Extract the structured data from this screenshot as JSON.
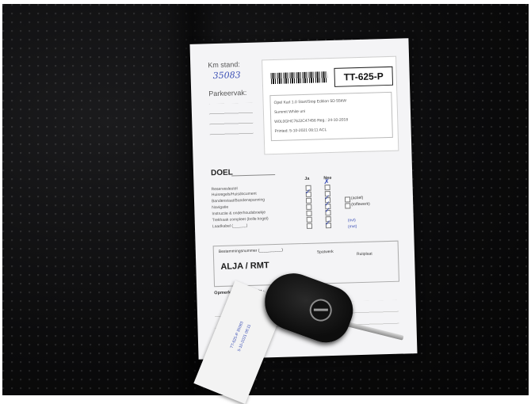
{
  "sheet": {
    "km_label": "Km stand:",
    "km_value": "35083",
    "park_label": "Parkeervak:",
    "plate": "TT-625-P",
    "info": [
      "Opel Karl 1.0 Start/Stop Edition 5D 55kW",
      "Summit White uni",
      "W0L0GHC76J2C47456          Reg.: 24-10-2018",
      "Printed: 5-10-2021 08:11                           ACL"
    ],
    "doel_label": "DOEL",
    "col_ja": "Ja",
    "col_nee": "Nee",
    "rows": [
      "Reservesleutel",
      "Huisregels/Huisdocument",
      "Bandenstaat/Bandenspanning",
      "Navigatie",
      "Instructie & onderhoudsboekje",
      "Trekhaak compleet (bolle kogel)",
      "Laadkabel (______)"
    ],
    "side_labels": [
      "(actief)",
      "(toffewerk)",
      "(ovt)",
      "(mvt)"
    ],
    "bestemming_label": "Bestemmingsnummer (__________)",
    "spatwerk_label": "Spatwerk",
    "ruitplaat_label": "Ruitplaat",
    "alja": "ALJA / RMT",
    "opmerkingen_label": "Opmerkingen voor SOL:"
  },
  "tag": {
    "lines": [
      "TT-625-P 35083",
      "5-10-2021 08:11"
    ]
  }
}
